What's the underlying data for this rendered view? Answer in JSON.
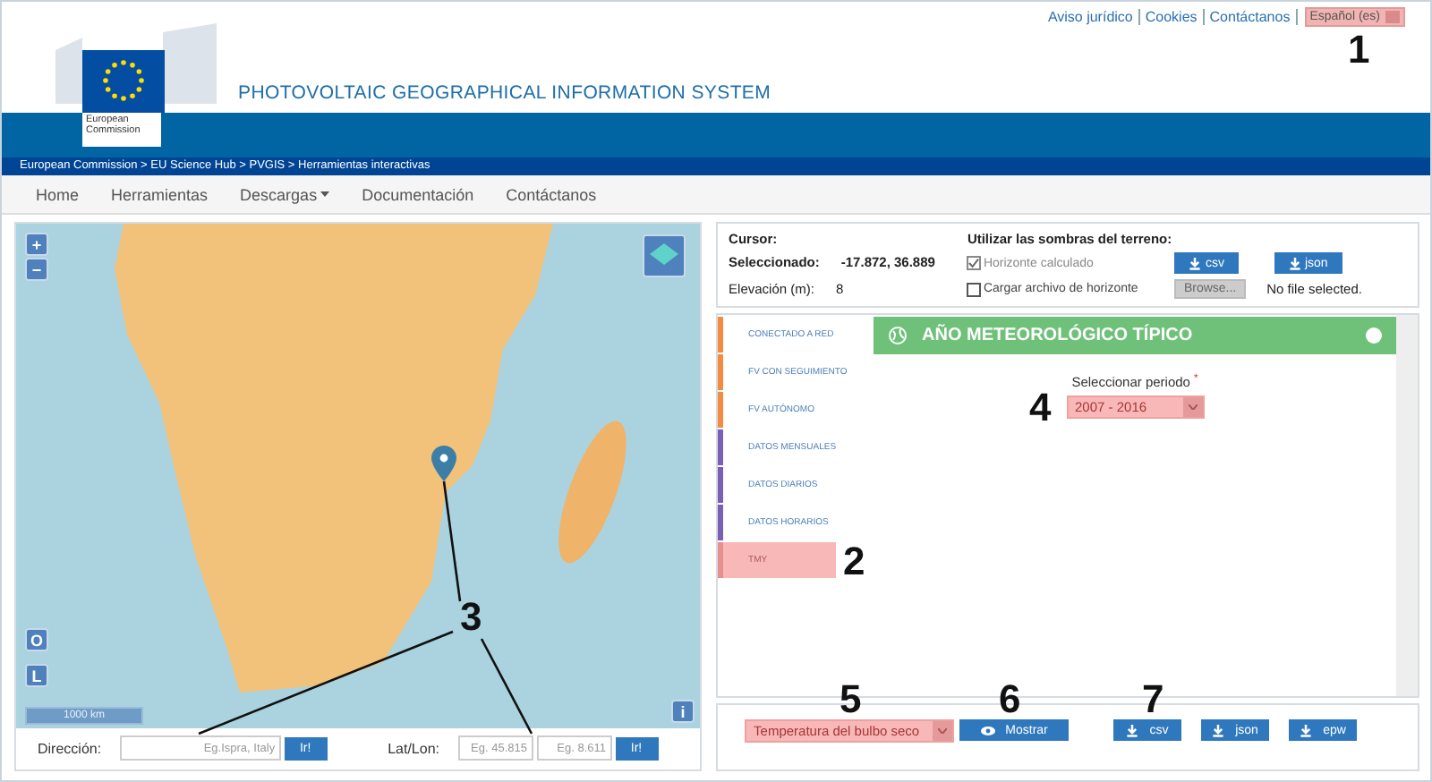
{
  "header": {
    "links": [
      "Aviso jurídico",
      "Cookies",
      "Contáctanos"
    ],
    "language": "Español (es)",
    "logo_text": "European Commission",
    "title": "PHOTOVOLTAIC GEOGRAPHICAL INFORMATION SYSTEM"
  },
  "breadcrumb": "European Commission > EU Science Hub > PVGIS > Herramientas interactivas",
  "nav": [
    {
      "label": "Home",
      "dropdown": false
    },
    {
      "label": "Herramientas",
      "dropdown": false
    },
    {
      "label": "Descargas",
      "dropdown": true
    },
    {
      "label": "Documentación",
      "dropdown": false
    },
    {
      "label": "Contáctanos",
      "dropdown": false
    }
  ],
  "map": {
    "zoom_in": "+",
    "zoom_out": "−",
    "side_buttons": [
      "O",
      "L"
    ],
    "scale": "1000 km",
    "info": "i"
  },
  "search": {
    "address_label": "Dirección:",
    "address_placeholder": "Eg.Ispra, Italy",
    "address_go": "Ir!",
    "latlon_label": "Lat/Lon:",
    "lat_placeholder": "Eg. 45.815",
    "lon_placeholder": "Eg. 8.611",
    "latlon_go": "Ir!"
  },
  "cursor": {
    "cursor_label": "Cursor:",
    "selected_label": "Seleccionado:",
    "selected_value": "-17.872, 36.889",
    "elevation_label": "Elevación (m):",
    "elevation_value": "8",
    "shadows_title": "Utilizar las sombras del terreno:",
    "options": [
      {
        "label": "Horizonte calculado",
        "checked": true
      },
      {
        "label": "Cargar archivo de horizonte",
        "checked": false
      }
    ],
    "downloads": [
      "csv",
      "json"
    ],
    "browse": "Browse...",
    "file_status": "No file selected."
  },
  "tools": [
    {
      "label": "CONECTADO A RED",
      "color": "#f58b3c",
      "selected": false
    },
    {
      "label": "FV CON SEGUIMIENTO",
      "color": "#f58b3c",
      "selected": false
    },
    {
      "label": "FV AUTÓNOMO",
      "color": "#f58b3c",
      "selected": false
    },
    {
      "label": "DATOS MENSUALES",
      "color": "#7b5fb5",
      "selected": false
    },
    {
      "label": "DATOS DIARIOS",
      "color": "#7b5fb5",
      "selected": false
    },
    {
      "label": "DATOS HORARIOS",
      "color": "#7b5fb5",
      "selected": false
    },
    {
      "label": "TMY",
      "color": "#e58f8f",
      "selected": true
    }
  ],
  "form": {
    "title": "AÑO METEOROLÓGICO TÍPICO",
    "period_label": "Seleccionar periodo",
    "required": "*",
    "period": "2007 - 2016"
  },
  "bottom": {
    "variable": "Temperatura del bulbo seco",
    "show": "Mostrar",
    "downloads": [
      "csv",
      "json",
      "epw"
    ]
  },
  "annotations": [
    "1",
    "2",
    "3",
    "4",
    "5",
    "6",
    "7"
  ]
}
